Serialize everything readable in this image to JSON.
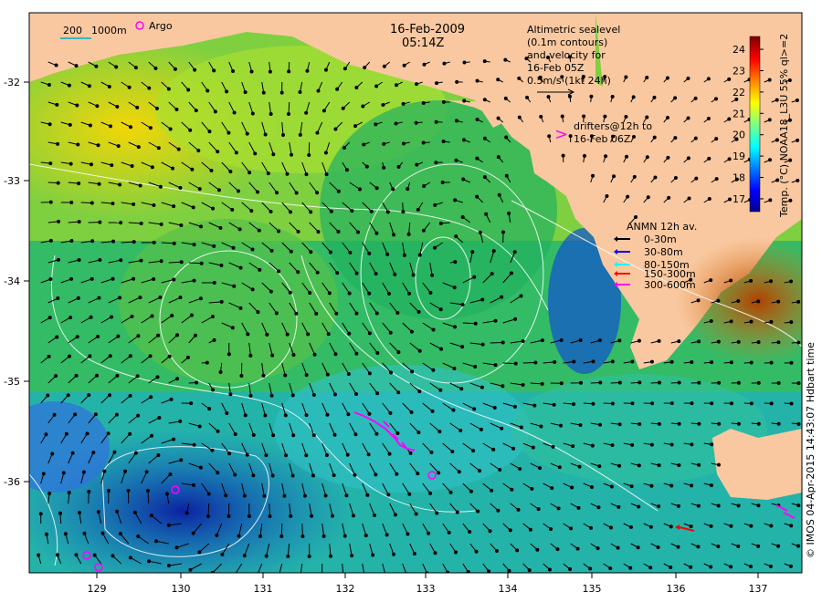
{
  "date_line": "16-Feb-2009",
  "time_line": "05:14Z",
  "scale_bar": {
    "label_200": "200",
    "label_1000": "1000m"
  },
  "argo_label": "Argo",
  "altimetry_text": [
    "Altimetric sealevel",
    "(0.1m contours)",
    "and velocity for",
    "16-Feb 05Z",
    "0.5m/s (1kt 24h)"
  ],
  "drifters_marker": ">",
  "drifters_text": [
    "drifters@12h to",
    "16-Feb 06Z"
  ],
  "anmn": {
    "title": "ANMN 12h av.",
    "items": [
      {
        "label": "0-30m",
        "color": "#000000"
      },
      {
        "label": "30-80m",
        "color": "#0000ff"
      },
      {
        "label": "80-150m",
        "color": "#00ffff"
      },
      {
        "label": "150-300m",
        "color": "#ff0000"
      },
      {
        "label": "300-600m",
        "color": "#ff00ff"
      }
    ]
  },
  "colorbar": {
    "title": "Temp. (°C) NOAA18_L3U  55% ql>=2",
    "ticks": [
      "17",
      "18",
      "19",
      "20",
      "21",
      "22",
      "23",
      "24"
    ],
    "min": 16.4,
    "max": 24.6,
    "colors": [
      "#00008f",
      "#0000ff",
      "#0080ff",
      "#00ffff",
      "#80ff80",
      "#ffff00",
      "#ff8000",
      "#ff0000",
      "#800000"
    ]
  },
  "x_ticks": [
    "129",
    "130",
    "131",
    "132",
    "133",
    "134",
    "135",
    "136",
    "137"
  ],
  "y_ticks": [
    "-32",
    "-33",
    "-34",
    "-35",
    "-36"
  ],
  "credit": "© IMOS 04-Apr-2015 14:43:07 Hdbart time",
  "colors": {
    "land": "#f9c8a0",
    "accent_magenta": "#ff00ff"
  }
}
